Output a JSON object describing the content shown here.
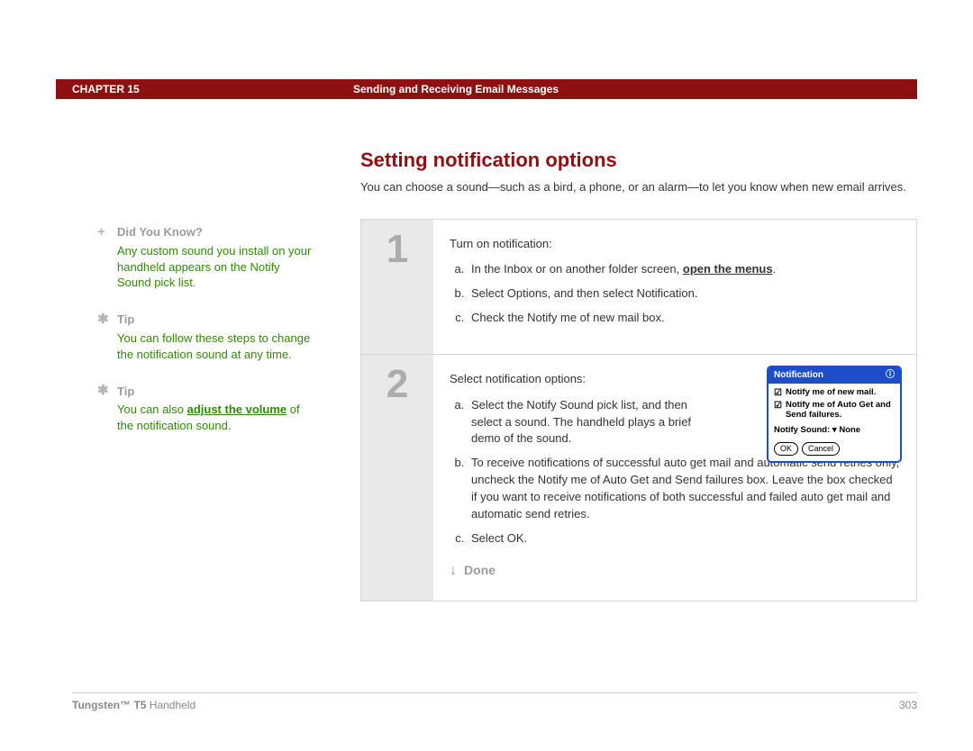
{
  "header": {
    "chapter": "CHAPTER 15",
    "title": "Sending and Receiving Email Messages"
  },
  "sidebar": [
    {
      "icon": "+",
      "heading": "Did You Know?",
      "body_plain": "Any custom sound you install on your handheld appears on the Notify Sound pick list."
    },
    {
      "icon": "✱",
      "heading": "Tip",
      "body_plain": "You can follow these steps to change the notification sound at any time."
    },
    {
      "icon": "✱",
      "heading": "Tip",
      "body_pre": "You can also ",
      "body_link": "adjust the volume",
      "body_post": " of the notification sound."
    }
  ],
  "main": {
    "section_title": "Setting notification options",
    "section_desc": "You can choose a sound—such as a bird, a phone, or an alarm—to let you know when new email arrives."
  },
  "steps": [
    {
      "num": "1",
      "lead": "Turn on notification:",
      "items": [
        {
          "pre": "In the Inbox or on another folder screen, ",
          "link": "open the menus",
          "post": "."
        },
        {
          "plain": "Select Options, and then select Notification."
        },
        {
          "plain": "Check the Notify me of new mail box."
        }
      ]
    },
    {
      "num": "2",
      "lead": "Select notification options:",
      "items": [
        {
          "plain": "Select the Notify Sound pick list, and then select a sound. The handheld plays a brief demo of the sound."
        },
        {
          "plain": "To receive notifications of successful auto get mail and automatic send retries only, uncheck the Notify me of Auto Get and Send failures box. Leave the box checked if you want to receive notifications of both successful and failed auto get mail and automatic send retries."
        },
        {
          "plain": "Select OK."
        }
      ],
      "done": "Done"
    }
  ],
  "dialog": {
    "title": "Notification",
    "check1": "Notify me of new mail.",
    "check2": "Notify me of Auto Get and Send failures.",
    "sound_label": "Notify Sound:",
    "sound_value": "None",
    "ok": "OK",
    "cancel": "Cancel"
  },
  "footer": {
    "product_bold": "Tungsten™ T5",
    "product_rest": " Handheld",
    "page": "303"
  }
}
